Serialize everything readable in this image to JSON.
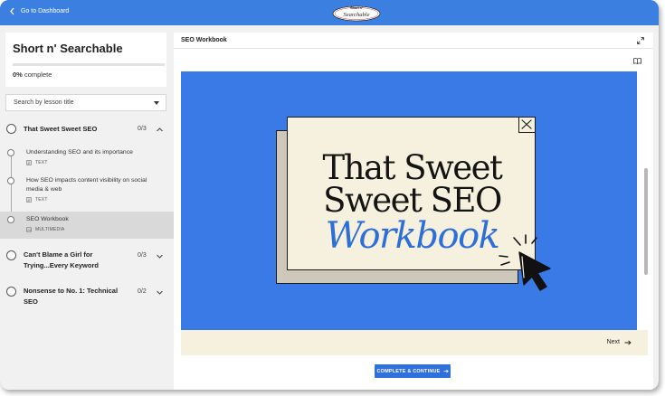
{
  "topbar": {
    "back_label": "Go to Dashboard",
    "logo_text": "Short n' Searchable"
  },
  "sidebar": {
    "course_title": "Short n' Searchable",
    "progress_percent": "0%",
    "progress_suffix": "complete",
    "progress_value": 0,
    "search_placeholder": "Search by lesson title",
    "sections": [
      {
        "title": "That Sweet Sweet SEO",
        "count": "0/3",
        "expanded": true,
        "lessons": [
          {
            "title": "Understanding SEO and its importance",
            "type": "TEXT"
          },
          {
            "title": "How SEO impacts content visibility on social media & web",
            "type": "TEXT"
          },
          {
            "title": "SEO Workbook",
            "type": "MULTIMEDIA",
            "active": true
          }
        ]
      },
      {
        "title": "Can't Blame a Girl for Trying...Every Keyword",
        "count": "0/3",
        "expanded": false
      },
      {
        "title": "Nonsense to No. 1: Technical SEO",
        "count": "0/2",
        "expanded": false
      }
    ]
  },
  "main": {
    "title": "SEO Workbook",
    "hero": {
      "line1": "That Sweet",
      "line2": "Sweet SEO",
      "line3": "Workbook"
    },
    "next_label": "Next",
    "complete_button": "COMPLETE & CONTINUE"
  },
  "colors": {
    "brand_blue": "#3b7fe0",
    "stage_blue": "#3a7ae6",
    "cream": "#f6f1df",
    "hero_accent": "#2e6ed8"
  }
}
